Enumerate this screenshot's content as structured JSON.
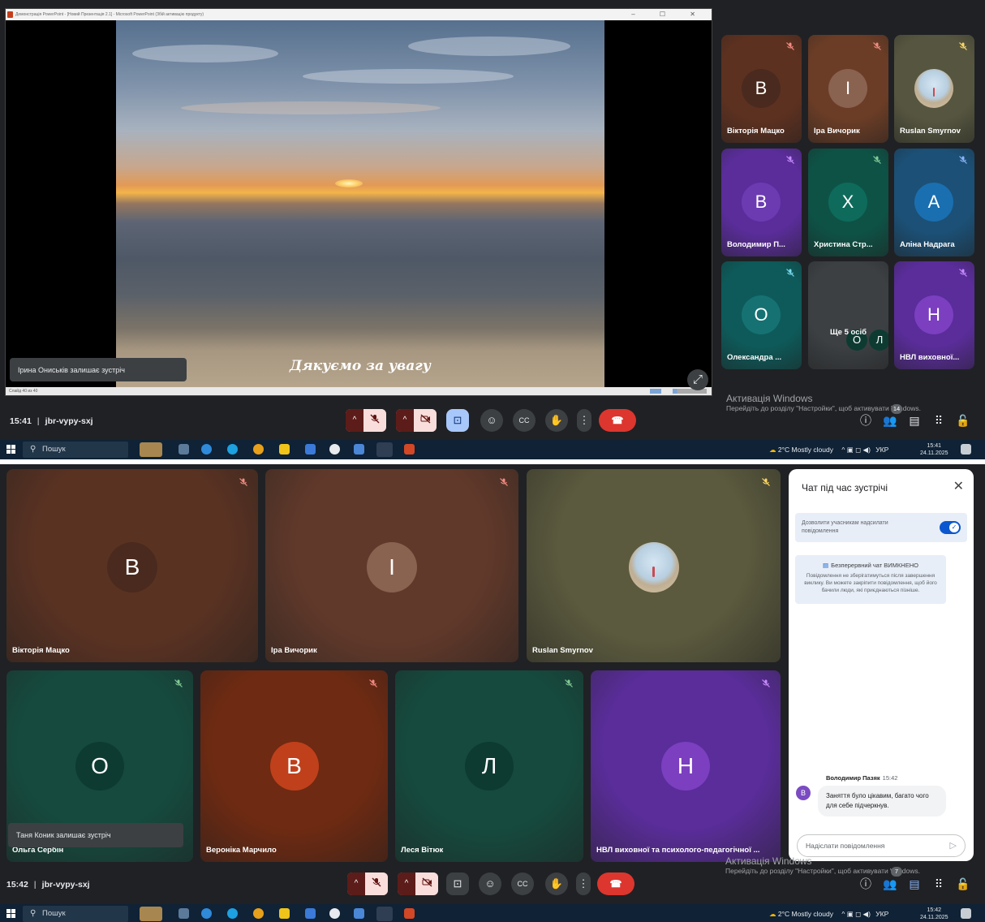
{
  "screenshot1": {
    "ppt_window": {
      "title": "Демонстрація PowerPoint - [Новий Презентація 2.1] - Microsoft PowerPoint (Збій активацію продукту)",
      "status_text": "Слайд 40 из 40"
    },
    "slide": {
      "caption": "Дякуємо за увагу"
    },
    "toast": "Ірина Ониськів залишає зустріч",
    "tiles": [
      {
        "name": "Вікторія Мацко",
        "initial": "В",
        "color": "#5d3120",
        "avatar": "#4a2a1e",
        "mic_color": "#f28b82"
      },
      {
        "name": "Іра Вичорик",
        "initial": "І",
        "color": "#6b3d26",
        "avatar": "#8a6250",
        "mic_color": "#f28b82"
      },
      {
        "name": "Ruslan Smyrnov",
        "initial": "",
        "color": "#565640",
        "avatar": "photo",
        "mic_color": "#fdd663"
      },
      {
        "name": "Володимир П...",
        "initial": "В",
        "color": "#5a2d9a",
        "avatar": "#6c3bb2",
        "mic_color": "#c58af9"
      },
      {
        "name": "Христина Стр...",
        "initial": "Х",
        "color": "#0e5246",
        "avatar": "#0e6b5b",
        "mic_color": "#81c995"
      },
      {
        "name": "Аліна Надрага",
        "initial": "А",
        "color": "#1c5076",
        "avatar": "#1a6fb0",
        "mic_color": "#8ab4f8"
      },
      {
        "name": "Олександра ...",
        "initial": "О",
        "color": "#0e5a5a",
        "avatar": "#167272",
        "mic_color": "#78d9ec"
      },
      {
        "name": "Ще 5 осіб",
        "initial": "",
        "color": "#3c4043",
        "avatar": "",
        "mic_color": ""
      },
      {
        "name": "НВЛ виховної...",
        "initial": "Н",
        "color": "#5a2d9a",
        "avatar": "#7b3fc0",
        "mic_color": "#c58af9"
      }
    ],
    "more_people": {
      "initials": [
        "О",
        "Л"
      ],
      "label": "Ще 5 осіб"
    },
    "meeting": {
      "time": "15:41",
      "code": "jbr-vypy-sxj"
    },
    "participants_count": "14",
    "activation": {
      "line1": "Активація Windows",
      "line2": "Перейдіть до розділу \"Настройки\", щоб активувати Windows."
    },
    "taskbar": {
      "search": "Пошук",
      "weather": "2°C  Mostly cloudy",
      "lang": "УКР",
      "time": "15:41",
      "date": "24.11.2025"
    }
  },
  "screenshot2": {
    "tiles": [
      {
        "name": "Вікторія Мацко",
        "initial": "В",
        "color": "#5a3222",
        "avatar": "#4a2a1e",
        "mic_color": "#f28b82"
      },
      {
        "name": "Іра Вичорик",
        "initial": "І",
        "color": "#61392a",
        "avatar": "#8a6250",
        "mic_color": "#f28b82"
      },
      {
        "name": "Ruslan Smyrnov",
        "initial": "",
        "color": "#5b5a3e",
        "avatar": "photo",
        "mic_color": "#fdd663"
      },
      {
        "name": "Ольга Сербін",
        "initial": "О",
        "color": "#164a3e",
        "avatar": "#0d3b32",
        "mic_color": "#81c995"
      },
      {
        "name": "Вероніка Марчило",
        "initial": "В",
        "color": "#6e2a12",
        "avatar": "#c0401b",
        "mic_color": "#f28b82"
      },
      {
        "name": "Леся Вітюк",
        "initial": "Л",
        "color": "#164a3e",
        "avatar": "#0d3b32",
        "mic_color": "#81c995"
      },
      {
        "name": "НВЛ виховної та психолого-педагогічної ...",
        "initial": "Н",
        "color": "#5a2d9a",
        "avatar": "#7b3fc0",
        "mic_color": "#c58af9"
      }
    ],
    "toast": "Таня Коник залишає зустріч",
    "chat": {
      "title": "Чат під час зустрічі",
      "allow": "Дозволити учасникам надсилати повідомлення",
      "info_title": "Безперервний чат ВИМКНЕНО",
      "info_body": "Повідомлення не зберігатимуться після завершення виклику. Ви можете закріпити повідомлення, щоб його бачили люди, які приєднаються пізніше.",
      "message": {
        "author": "Володимир Пазяк",
        "time": "15:42",
        "initial": "В",
        "text": "Заняття було цікавим, багато чого для себе підчеркнув."
      },
      "input_placeholder": "Надіслати повідомлення"
    },
    "meeting": {
      "time": "15:42",
      "code": "jbr-vypy-sxj"
    },
    "participants_count": "7",
    "activation": {
      "line1": "Активація Windows",
      "line2": "Перейдіть до розділу \"Настройки\", щоб активувати Windows."
    },
    "taskbar": {
      "search": "Пошук",
      "weather": "2°C  Mostly cloudy",
      "lang": "УКР",
      "time": "15:42",
      "date": "24.11.2025"
    }
  },
  "icons": {
    "mic_off": "mic-off-icon",
    "cam_off": "camera-off-icon",
    "present": "present-screen-icon",
    "emoji": "emoji-icon",
    "captions": "captions-icon",
    "hand": "raise-hand-icon",
    "more": "more-vert-icon",
    "end": "end-call-icon",
    "info": "info-icon",
    "people": "people-icon",
    "chat": "chat-icon",
    "activities": "apps-icon",
    "lock": "host-controls-icon"
  }
}
